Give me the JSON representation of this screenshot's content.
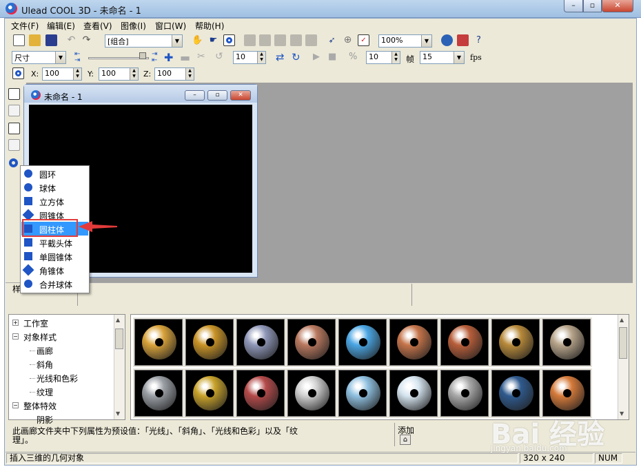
{
  "window": {
    "title": "Ulead COOL 3D - 未命名 - 1",
    "minimize": "–",
    "maximize": "▫",
    "close": "✕"
  },
  "menu": [
    "文件(F)",
    "编辑(E)",
    "查看(V)",
    "图像(I)",
    "窗口(W)",
    "帮助(H)"
  ],
  "toolbar": {
    "group_select": "[组合]",
    "zoom": "100%",
    "size_select": "尺寸",
    "slider_value": 0.95,
    "spin1": "10",
    "spin2": "10",
    "frame_label": "帧",
    "frame_value": "15",
    "fps_label": "fps",
    "x_label": "X:",
    "x_value": "100",
    "y_label": "Y:",
    "y_value": "100",
    "z_label": "Z:",
    "z_value": "100"
  },
  "child_window": {
    "title": "未命名 - 1"
  },
  "dropdown": {
    "items": [
      "圆环",
      "球体",
      "立方体",
      "圆锥体",
      "圆柱体",
      "平截头体",
      "单圆锥体",
      "角锥体",
      "合并球体"
    ],
    "selected_index": 4
  },
  "midstrip": {
    "label": "样"
  },
  "tree": {
    "items": [
      {
        "label": "工作室",
        "box": "+"
      },
      {
        "label": "对象样式",
        "box": "−"
      },
      {
        "label": "画廊",
        "child": true
      },
      {
        "label": "斜角",
        "child": true
      },
      {
        "label": "光线和色彩",
        "child": true
      },
      {
        "label": "纹理",
        "child": true
      },
      {
        "label": "整体特效",
        "box": "−"
      },
      {
        "label": "阴影",
        "child": true
      }
    ]
  },
  "gallery": {
    "colors": [
      "#d8a23a",
      "#c99326",
      "#8f97b8",
      "#b9785e",
      "#4aa6e4",
      "#c5744a",
      "#b85e3a",
      "#b88a3a",
      "#b7a48a",
      "#9a9fa5",
      "#c8a22a",
      "#b54a4a",
      "#d0d0d0",
      "#8fc0e0",
      "#d5e4ef",
      "#a9a9a9",
      "#2f5a8e",
      "#d57a3a"
    ]
  },
  "description": {
    "line1": "此画廊文件夹中下列属性为预设值：「光线」、「斜角」、「光线和色彩」以及「纹",
    "line2": "理」。",
    "add": "添加"
  },
  "statusbar": {
    "message": "插入三维的几何对象",
    "size": "320 x 240",
    "num": "NUM"
  },
  "watermark": {
    "text": "Bai 经验",
    "sub": "jingyan.baidu.com"
  }
}
